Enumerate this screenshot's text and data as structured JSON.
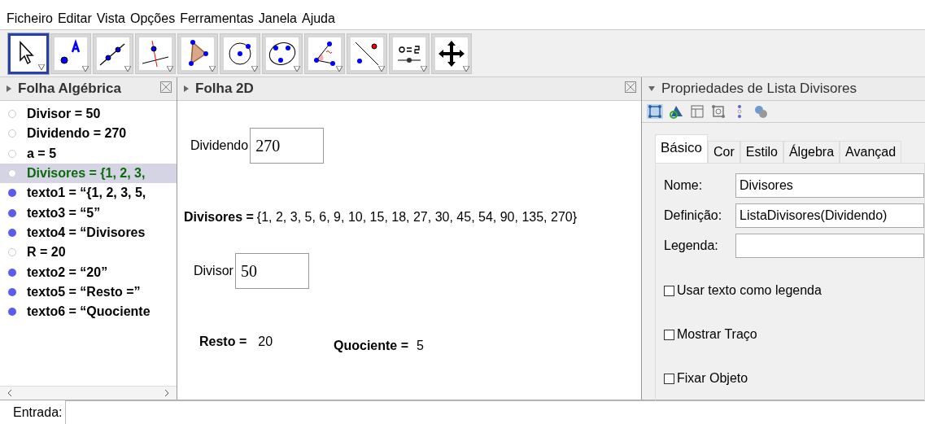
{
  "menu": [
    "Ficheiro",
    "Editar",
    "Vista",
    "Opções",
    "Ferramentas",
    "Janela",
    "Ajuda"
  ],
  "toolbar": [
    {
      "kind": "pointer",
      "selected": true
    },
    {
      "kind": "point",
      "selected": false
    },
    {
      "kind": "line",
      "selected": false
    },
    {
      "kind": "perpendicular",
      "selected": false
    },
    {
      "kind": "polygon",
      "selected": false
    },
    {
      "kind": "circle",
      "selected": false
    },
    {
      "kind": "conic",
      "selected": false
    },
    {
      "kind": "angle",
      "selected": false
    },
    {
      "kind": "reflect",
      "selected": false
    },
    {
      "kind": "slider",
      "selected": false
    },
    {
      "kind": "move",
      "selected": false
    }
  ],
  "algebra": {
    "title": "Folha Algébrica",
    "items": [
      {
        "text": "Divisor = 50",
        "visible": false,
        "selected": false
      },
      {
        "text": "Dividendo = 270",
        "visible": false,
        "selected": false
      },
      {
        "text": "a = 5",
        "visible": false,
        "selected": false
      },
      {
        "text": "Divisores = {1, 2, 3,",
        "visible": false,
        "selected": true
      },
      {
        "text": "texto1 = “{1, 2, 3, 5,",
        "visible": true,
        "selected": false
      },
      {
        "text": "texto3 = “5”",
        "visible": true,
        "selected": false
      },
      {
        "text": "texto4 = “Divisores",
        "visible": true,
        "selected": false
      },
      {
        "text": "R = 20",
        "visible": false,
        "selected": false
      },
      {
        "text": "texto2 = “20”",
        "visible": true,
        "selected": false
      },
      {
        "text": "texto5 = “Resto =”",
        "visible": true,
        "selected": false
      },
      {
        "text": "texto6 = “Quociente",
        "visible": true,
        "selected": false
      }
    ]
  },
  "graphics": {
    "title": "Folha 2D",
    "dividend": {
      "label": "Dividendo",
      "value": "270"
    },
    "divisors": {
      "label": "Divisores =",
      "value": "{1, 2, 3, 5, 6, 9, 10, 15, 18, 27, 30, 45, 54, 90, 135, 270}"
    },
    "divisor": {
      "label": "Divisor",
      "value": "50"
    },
    "remainder": {
      "label": "Resto =",
      "value": "20"
    },
    "quotient": {
      "label": "Quociente =",
      "value": "5"
    }
  },
  "properties": {
    "title": "Propriedades de Lista Divisores",
    "icons": [
      {
        "kind": "graphics",
        "selected": true
      },
      {
        "kind": "shapes",
        "selected": false
      },
      {
        "kind": "table",
        "selected": false
      },
      {
        "kind": "graphics2",
        "selected": false
      },
      {
        "kind": "dots",
        "selected": false
      },
      {
        "kind": "gears",
        "selected": false
      }
    ],
    "tabs": [
      {
        "label": "Básico",
        "selected": true
      },
      {
        "label": "Cor",
        "selected": false
      },
      {
        "label": "Estilo",
        "selected": false
      },
      {
        "label": "Álgebra",
        "selected": false
      },
      {
        "label": "Avançad",
        "selected": false
      }
    ],
    "fields": [
      {
        "label": "Nome:",
        "value": "Divisores"
      },
      {
        "label": "Definição:",
        "value": "ListaDivisores(Dividendo)"
      },
      {
        "label": "Legenda:"
      }
    ],
    "checkboxes": [
      {
        "label": "Usar texto como legenda",
        "checked": false
      },
      {
        "label": "Mostrar Traço",
        "checked": false
      },
      {
        "label": "Fixar Objeto",
        "checked": false
      }
    ]
  },
  "input_bar": {
    "label": "Entrada:"
  }
}
